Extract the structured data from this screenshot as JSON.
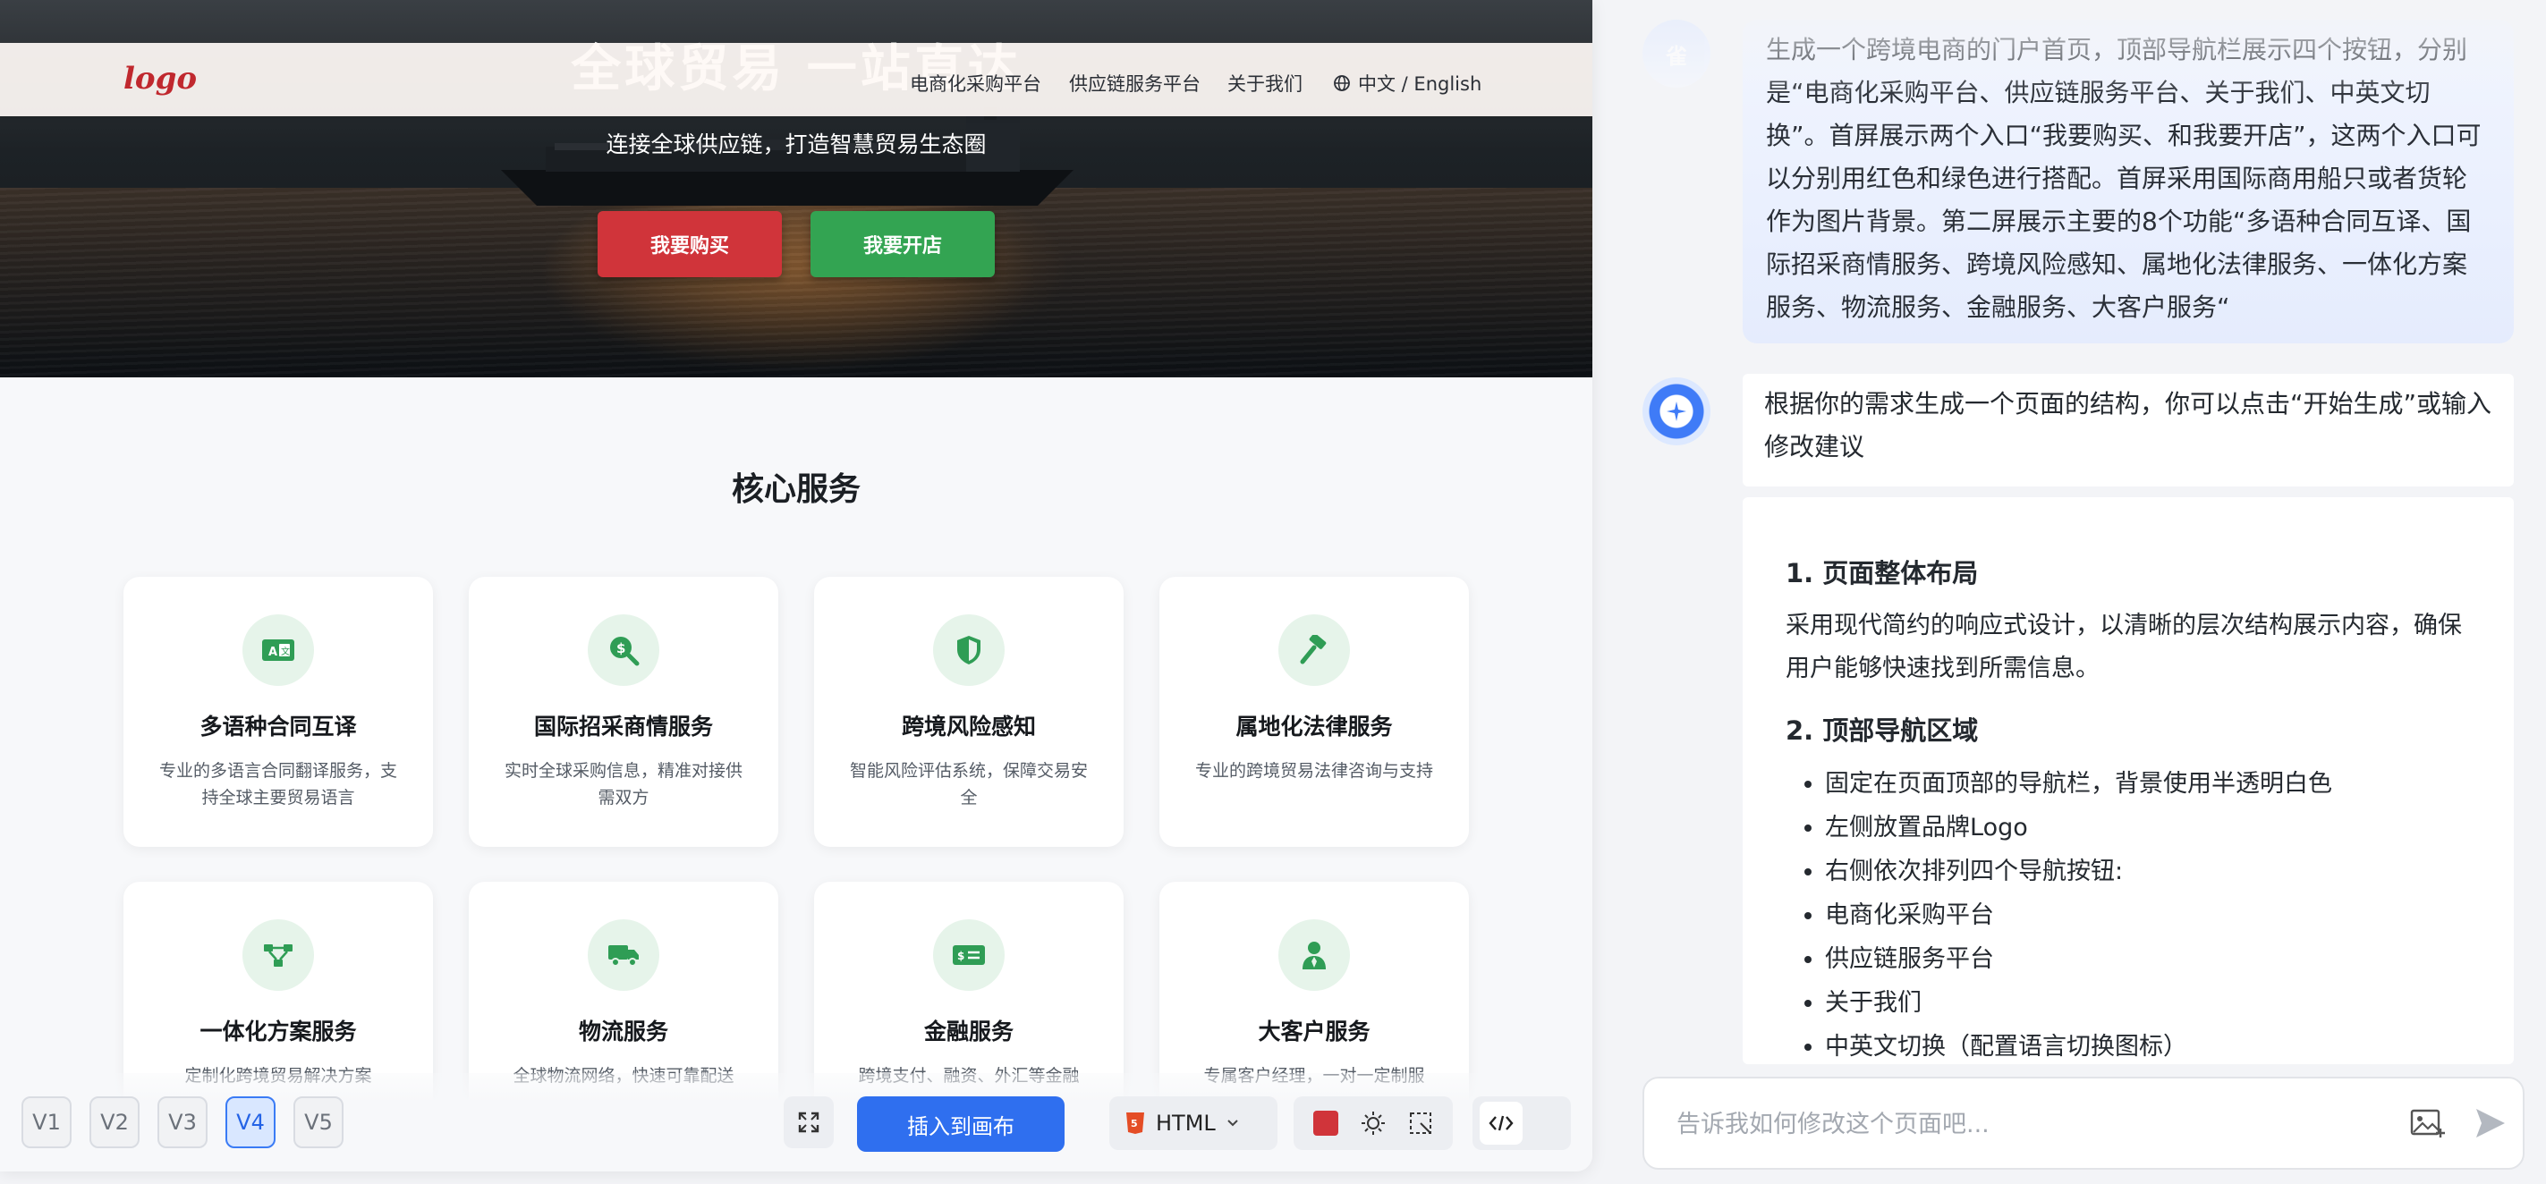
{
  "preview": {
    "hero": {
      "title": "全球贸易 一站直达",
      "subtitle": "连接全球供应链，打造智慧贸易生态圈",
      "buy_label": "我要购买",
      "shop_label": "我要开店"
    },
    "nav": {
      "logo": "logo",
      "items": [
        "电商化采购平台",
        "供应链服务平台",
        "关于我们",
        "中文 / English"
      ]
    },
    "section_title": "核心服务",
    "cards": [
      {
        "title": "多语种合同互译",
        "desc": "专业的多语言合同翻译服务，支持全球主要贸易语言",
        "icon": "translate-icon"
      },
      {
        "title": "国际招采商情服务",
        "desc": "实时全球采购信息，精准对接供需双方",
        "icon": "search-dollar-icon"
      },
      {
        "title": "跨境风险感知",
        "desc": "智能风险评估系统，保障交易安全",
        "icon": "shield-icon"
      },
      {
        "title": "属地化法律服务",
        "desc": "专业的跨境贸易法律咨询与支持",
        "icon": "gavel-icon"
      },
      {
        "title": "一体化方案服务",
        "desc": "定制化跨境贸易解决方案",
        "icon": "network-icon"
      },
      {
        "title": "物流服务",
        "desc": "全球物流网络，快速可靠配送",
        "icon": "truck-icon"
      },
      {
        "title": "金融服务",
        "desc": "跨境支付、融资、外汇等金融",
        "icon": "money-icon"
      },
      {
        "title": "大客户服务",
        "desc": "专属客户经理，一对一定制服",
        "icon": "user-tie-icon"
      }
    ]
  },
  "toolbar": {
    "versions": [
      "V1",
      "V2",
      "V3",
      "V4",
      "V5"
    ],
    "active_version": "V4",
    "insert_label": "插入到画布",
    "format_label": "HTML",
    "accent_color": "#d0343a"
  },
  "chat": {
    "user_avatar_text": "雀",
    "user_message": "生成一个跨境电商的门户首页，顶部导航栏展示四个按钮，分别是“电商化采购平台、供应链服务平台、关于我们、中英文切换”。首屏展示两个入口“我要购买、和我要开店”，这两个入口可以分别用红色和绿色进行搭配。首屏采用国际商用船只或者货轮作为图片背景。第二屏展示主要的8个功能“多语种合同互译、国际招采商情服务、跨境风险感知、属地化法律服务、一体化方案服务、物流服务、金融服务、大客户服务“",
    "ai_message": "根据你的需求生成一个页面的结构，你可以点击“开始生成”或输入修改建议",
    "doc": {
      "h1": "1. 页面整体布局",
      "p1": "采用现代简约的响应式设计，以清晰的层次结构展示内容，确保用户能够快速找到所需信息。",
      "h2": "2. 顶部导航区域",
      "bullets": [
        "固定在页面顶部的导航栏，背景使用半透明白色",
        "左侧放置品牌Logo",
        "右侧依次排列四个导航按钮:",
        "电商化采购平台",
        "供应链服务平台",
        "关于我们",
        "中英文切换（配置语言切换图标）"
      ]
    },
    "input_placeholder": "告诉我如何修改这个页面吧..."
  }
}
